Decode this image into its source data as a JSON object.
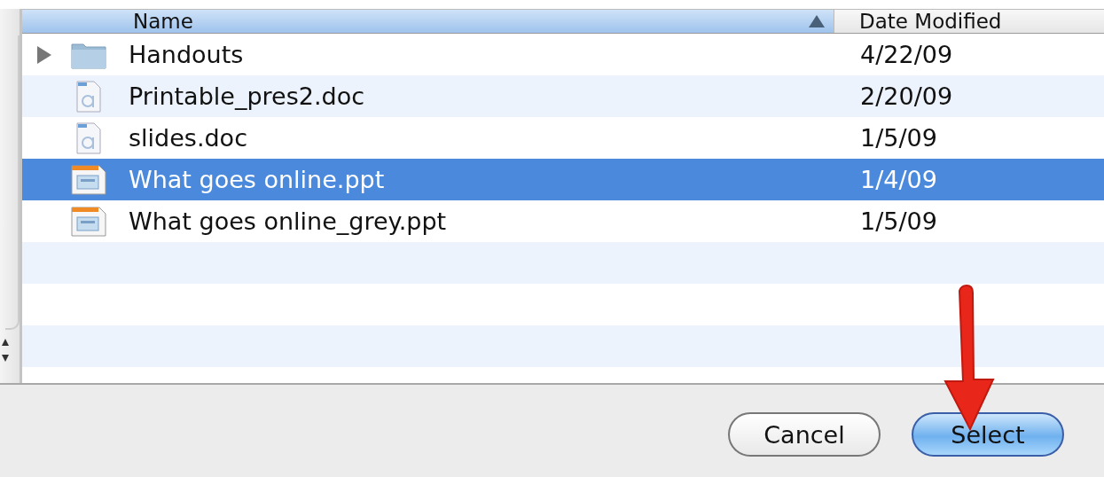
{
  "table": {
    "columns": [
      {
        "label": "Name",
        "sorted": true
      },
      {
        "label": "Date Modified",
        "sorted": false
      }
    ],
    "rows": [
      {
        "kind": "folder",
        "name": "Handouts",
        "date": "4/22/09",
        "selected": false
      },
      {
        "kind": "doc",
        "name": "Printable_pres2.doc",
        "date": "2/20/09",
        "selected": false
      },
      {
        "kind": "doc",
        "name": "slides.doc",
        "date": "1/5/09",
        "selected": false
      },
      {
        "kind": "ppt",
        "name": "What goes online.ppt",
        "date": "1/4/09",
        "selected": true
      },
      {
        "kind": "ppt",
        "name": "What goes online_grey.ppt",
        "date": "1/5/09",
        "selected": false
      }
    ]
  },
  "buttons": [
    {
      "label": "Cancel",
      "default": false
    },
    {
      "label": "Select",
      "default": true
    }
  ]
}
